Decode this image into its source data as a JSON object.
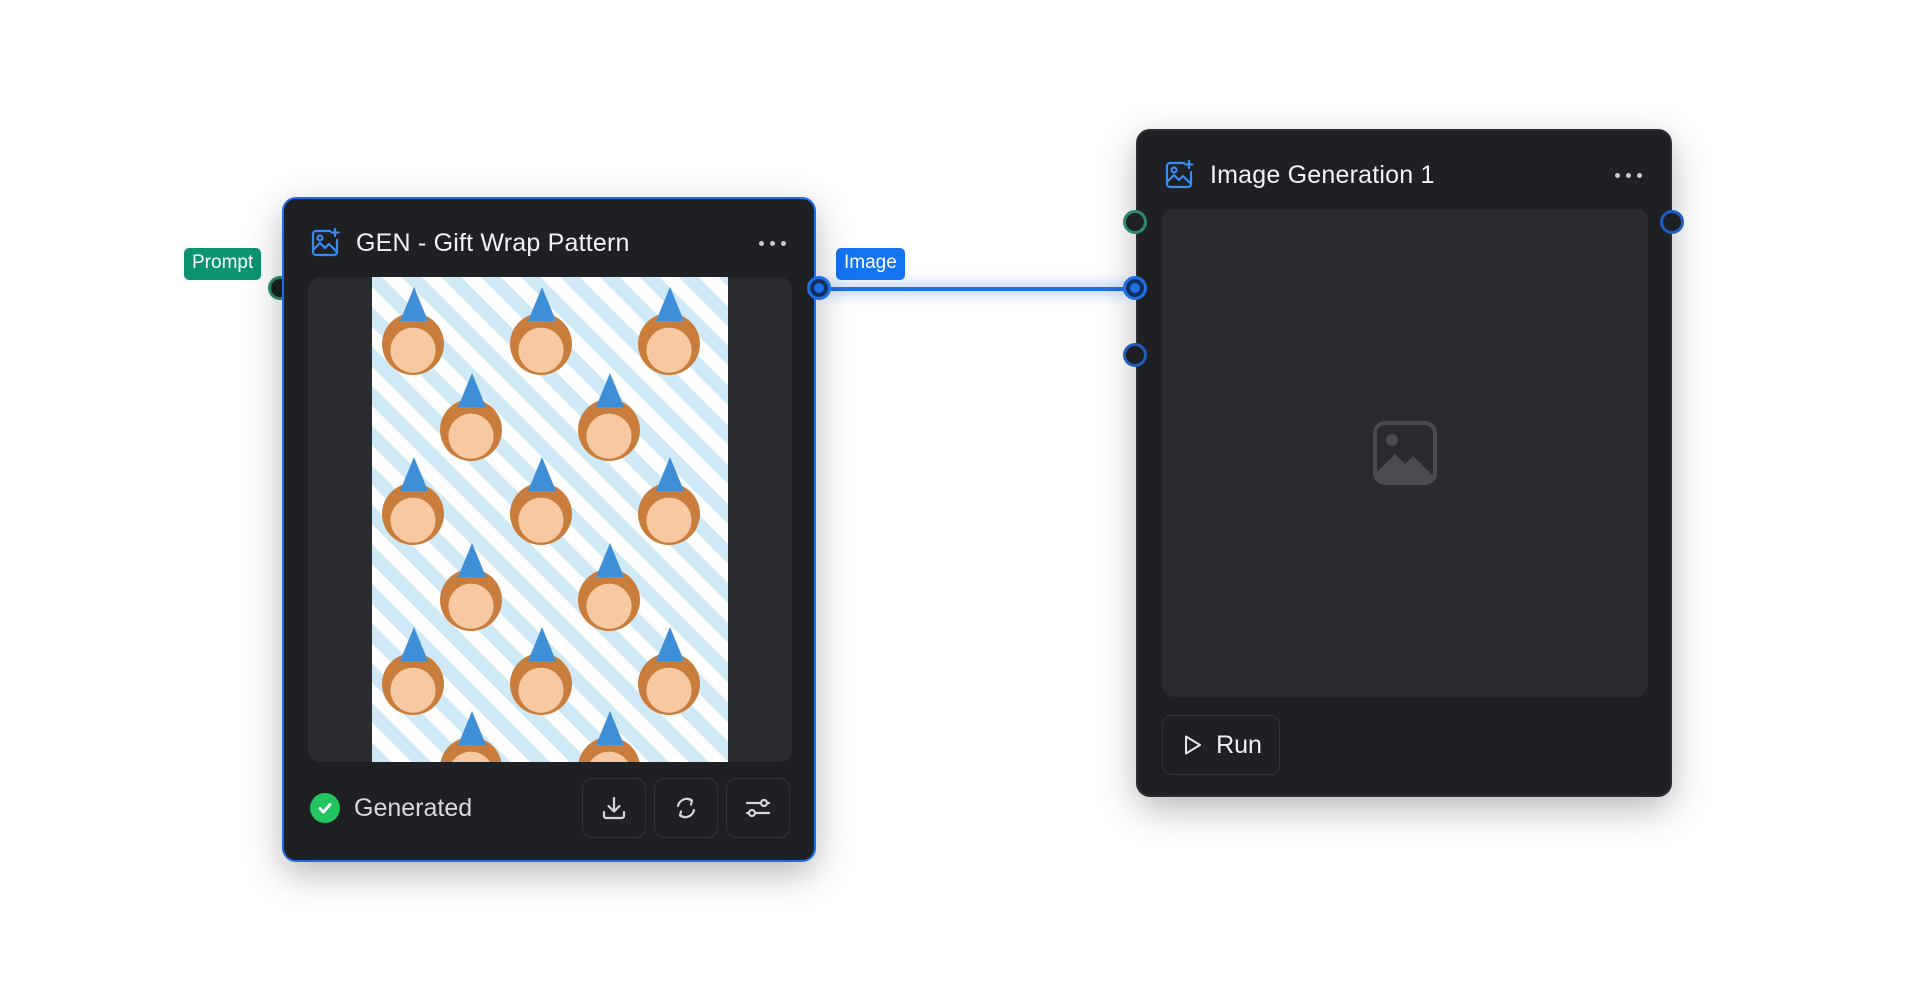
{
  "canvas": {
    "edge_color": "#1f6fe6"
  },
  "node_gen": {
    "title": "GEN - Gift Wrap Pattern",
    "icon": "image-sparkle-icon",
    "input_label": "Prompt",
    "output_label": "Image",
    "status": "Generated",
    "status_icon": "check-circle-icon",
    "status_color": "#22c55e",
    "actions": [
      "download-icon",
      "regenerate-icon",
      "settings-sliders-icon"
    ],
    "preview": "gift wrap pattern image"
  },
  "node_image": {
    "title": "Image Generation 1",
    "icon": "image-sparkle-icon",
    "placeholder_icon": "image-placeholder-icon",
    "run_label": "Run",
    "run_icon": "play-icon"
  },
  "colors": {
    "accent": "#1e6ee8",
    "prompt_tag": "#0c9370",
    "image_tag": "#1473f0",
    "node_bg": "#1f2023",
    "panel_bg": "#2a2b2f"
  }
}
